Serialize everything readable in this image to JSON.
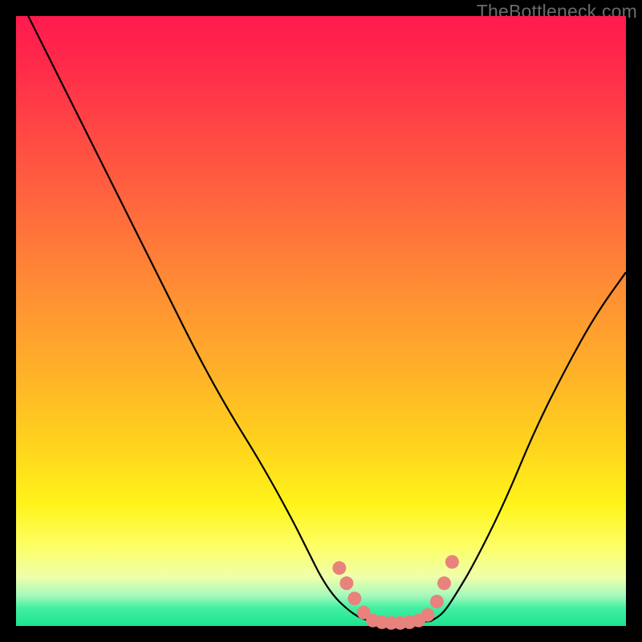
{
  "attribution": "TheBottleneck.com",
  "chart_data": {
    "type": "line",
    "title": "",
    "xlabel": "",
    "ylabel": "",
    "xlim": [
      0,
      100
    ],
    "ylim": [
      0,
      100
    ],
    "series": [
      {
        "name": "left-branch",
        "x": [
          2,
          6,
          10,
          15,
          20,
          25,
          30,
          35,
          40,
          45,
          48,
          50,
          52,
          54,
          56,
          58
        ],
        "values": [
          100,
          92,
          84,
          74,
          64,
          54,
          44,
          35,
          27,
          18,
          12,
          8,
          5,
          3,
          1.5,
          0.8
        ]
      },
      {
        "name": "flat-bottom",
        "x": [
          58,
          60,
          62,
          64,
          66,
          68
        ],
        "values": [
          0.8,
          0.6,
          0.5,
          0.5,
          0.6,
          0.8
        ]
      },
      {
        "name": "right-branch",
        "x": [
          68,
          70,
          72,
          75,
          80,
          85,
          90,
          95,
          100
        ],
        "values": [
          0.8,
          2,
          5,
          10,
          20,
          32,
          42,
          51,
          58
        ]
      }
    ],
    "markers": {
      "name": "threshold-dots",
      "color": "#e8827d",
      "points": [
        {
          "x": 53,
          "y": 9.5
        },
        {
          "x": 54.2,
          "y": 7
        },
        {
          "x": 55.5,
          "y": 4.5
        },
        {
          "x": 57,
          "y": 2.2
        },
        {
          "x": 58.5,
          "y": 0.9
        },
        {
          "x": 60,
          "y": 0.6
        },
        {
          "x": 61.5,
          "y": 0.5
        },
        {
          "x": 63,
          "y": 0.5
        },
        {
          "x": 64.5,
          "y": 0.6
        },
        {
          "x": 66,
          "y": 0.9
        },
        {
          "x": 67.5,
          "y": 1.8
        },
        {
          "x": 69,
          "y": 4
        },
        {
          "x": 70.2,
          "y": 7
        },
        {
          "x": 71.5,
          "y": 10.5
        }
      ]
    },
    "background": {
      "type": "vertical-gradient",
      "stops": [
        {
          "pos": 0,
          "color": "#ff1a4f"
        },
        {
          "pos": 45,
          "color": "#ff8e34"
        },
        {
          "pos": 80,
          "color": "#fff31a"
        },
        {
          "pos": 100,
          "color": "#1be48e"
        }
      ]
    }
  }
}
